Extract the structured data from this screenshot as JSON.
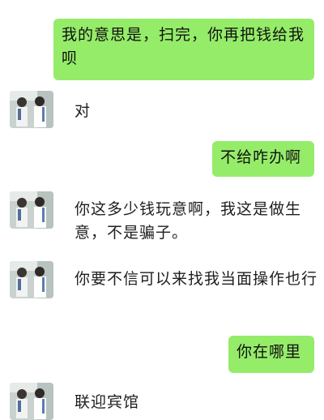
{
  "messages": [
    {
      "sender": "me",
      "text": "我的意思是，扫完，你再把钱给我呗"
    },
    {
      "sender": "contact",
      "text": "对"
    },
    {
      "sender": "me",
      "text": "不给咋办啊"
    },
    {
      "sender": "contact",
      "text": "你这多少钱玩意啊，我这是做生意，不是骗子。"
    },
    {
      "sender": "contact",
      "text": "你要不信可以来找我当面操作也行"
    },
    {
      "sender": "me",
      "text": "你在哪里"
    },
    {
      "sender": "contact",
      "text": "联迎宾馆"
    }
  ],
  "colors": {
    "sent_bubble": "#95ec69",
    "background": "#ffffff"
  },
  "icons": {
    "avatar": "contact-avatar-photo"
  }
}
